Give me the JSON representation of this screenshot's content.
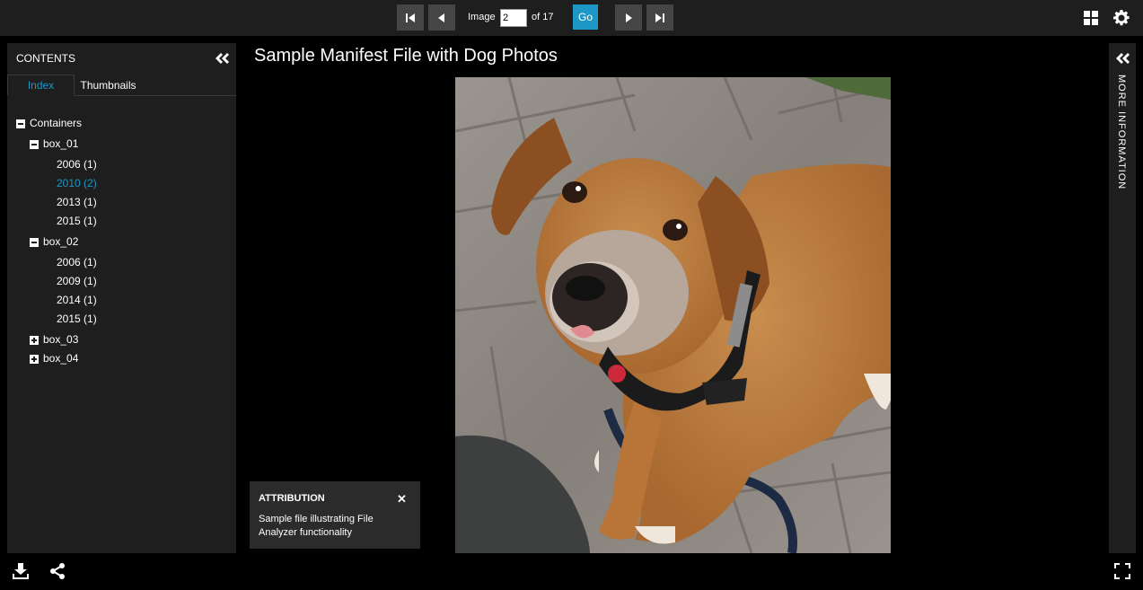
{
  "toolbar": {
    "image_label": "Image",
    "image_value": "2",
    "of_label": "of 17",
    "go_label": "Go"
  },
  "left_panel": {
    "title": "CONTENTS",
    "tabs": [
      "Index",
      "Thumbnails"
    ],
    "tree": {
      "root": "Containers",
      "box_01": "box_01",
      "box_01_items": [
        "2006 (1)",
        "2010 (2)",
        "2013 (1)",
        "2015 (1)"
      ],
      "box_02": "box_02",
      "box_02_items": [
        "2006 (1)",
        "2009 (1)",
        "2014 (1)",
        "2015 (1)"
      ],
      "box_03": "box_03",
      "box_04": "box_04"
    }
  },
  "main": {
    "title": "Sample Manifest File with Dog Photos"
  },
  "attribution": {
    "title": "ATTRIBUTION",
    "close": "✕",
    "text": "Sample file illustrating File Analyzer functionality"
  },
  "right_panel": {
    "label": "MORE INFORMATION"
  },
  "colors": {
    "accent": "#1d97c5",
    "panel": "#1f1e1e",
    "background": "#000000"
  }
}
